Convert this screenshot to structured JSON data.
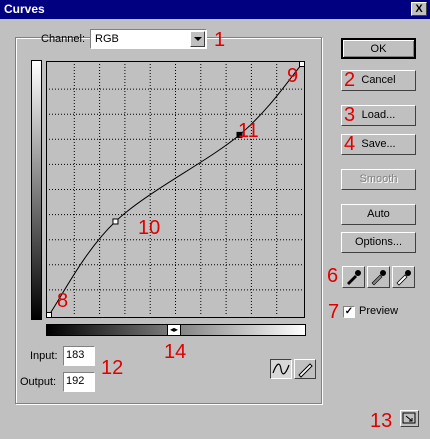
{
  "window": {
    "title": "Curves",
    "close_glyph": "X"
  },
  "channel": {
    "label": "Channel:",
    "value": "RGB"
  },
  "curve": {
    "points": [
      [
        0,
        0
      ],
      [
        67,
        95
      ],
      [
        192,
        183
      ],
      [
        255,
        255
      ]
    ],
    "grid_divisions": 10
  },
  "input": {
    "label": "Input:",
    "value": "183"
  },
  "output": {
    "label": "Output:",
    "value": "192"
  },
  "buttons": {
    "ok": "OK",
    "cancel": "Cancel",
    "load": "Load...",
    "save": "Save...",
    "smooth": "Smooth",
    "auto": "Auto",
    "options": "Options..."
  },
  "preview": {
    "label": "Preview",
    "checked": true
  },
  "gradient_arrows": "◂▸",
  "annotations": {
    "a1": "1",
    "a2": "2",
    "a3": "3",
    "a4": "4",
    "a6": "6",
    "a7": "7",
    "a8": "8",
    "a9": "9",
    "a10": "10",
    "a11": "11",
    "a12": "12",
    "a13": "13",
    "a14": "14"
  },
  "colors": {
    "titlebar": "#000080",
    "annotation": "#e00000"
  }
}
